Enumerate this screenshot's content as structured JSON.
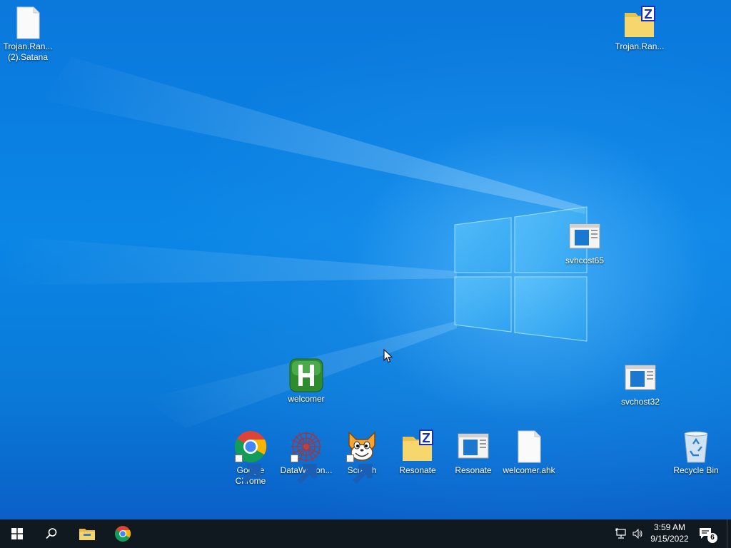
{
  "desktop": {
    "icons": {
      "trojan_satana": {
        "label": "Trojan.Ran...\n(2).Satana",
        "icon": "blank-file-icon"
      },
      "trojan_zip": {
        "label": "Trojan.Ran...",
        "icon": "zip-folder-icon"
      },
      "svhcost65": {
        "label": "svhcost65",
        "icon": "window-app-icon"
      },
      "welcomer": {
        "label": "welcomer",
        "icon": "autohotkey-h-icon"
      },
      "svchost32": {
        "label": "svchost32",
        "icon": "window-app-icon"
      },
      "google_chrome": {
        "label": "Google\nChrome",
        "icon": "chrome-icon"
      },
      "datawagon": {
        "label": "DataWagon...",
        "icon": "datawagon-icon"
      },
      "scratch": {
        "label": "Scratch",
        "icon": "scratch-cat-icon"
      },
      "resonate_zip": {
        "label": "Resonate",
        "icon": "zip-folder-icon"
      },
      "resonate_app": {
        "label": "Resonate",
        "icon": "window-app-icon"
      },
      "welcomer_ahk": {
        "label": "welcomer.ahk",
        "icon": "blank-file-icon"
      },
      "recycle_bin": {
        "label": "Recycle Bin",
        "icon": "recycle-bin-icon"
      }
    }
  },
  "taskbar": {
    "clock": {
      "time": "3:59 AM",
      "date": "9/15/2022"
    },
    "notifications": {
      "count": "6"
    }
  },
  "colors": {
    "taskbar": "#101820",
    "accent": "#0a78d8",
    "zip_badge": "#1a2fb8",
    "folder_yellow": "#f5d76e"
  }
}
